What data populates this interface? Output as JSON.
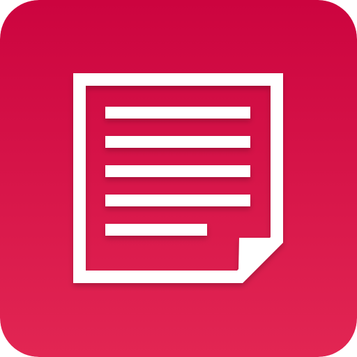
{
  "app_icon": {
    "icon": "document-note-icon",
    "colors": {
      "background_top": "#CC043F",
      "background_bottom": "#E22653",
      "glyph": "#FFFFFF"
    },
    "text_lines": 5
  }
}
